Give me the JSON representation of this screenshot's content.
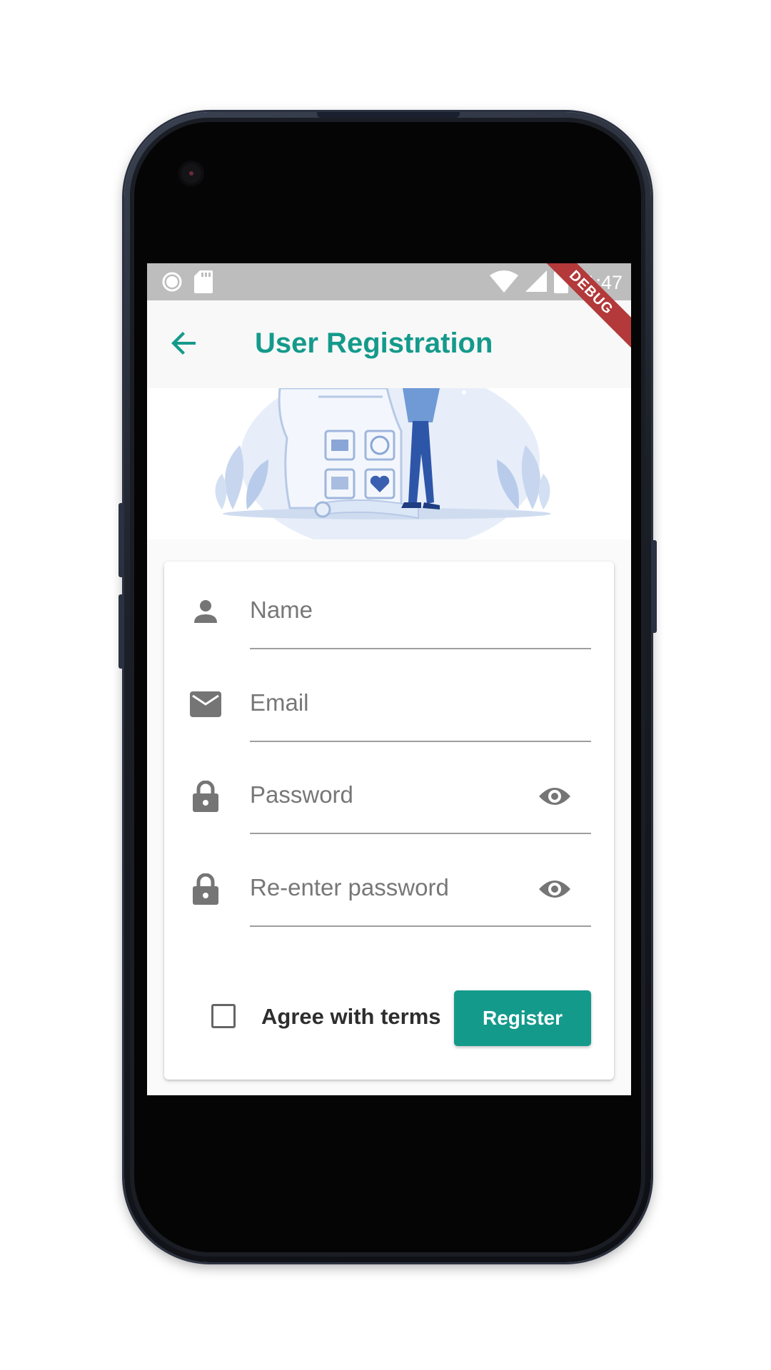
{
  "statusbar": {
    "time": "11:47",
    "icons": [
      "record-icon",
      "sd-card-icon",
      "wifi-icon",
      "signal-icon",
      "battery-icon"
    ]
  },
  "appbar": {
    "title": "User Registration",
    "back_icon": "arrow-back-icon",
    "debug_banner": "DEBUG"
  },
  "form": {
    "fields": [
      {
        "icon": "person-icon",
        "placeholder": "Name",
        "value": ""
      },
      {
        "icon": "email-icon",
        "placeholder": "Email",
        "value": ""
      },
      {
        "icon": "lock-icon",
        "placeholder": "Password",
        "value": "",
        "toggle_icon": "eye-icon"
      },
      {
        "icon": "lock-icon",
        "placeholder": "Re-enter password",
        "value": "",
        "toggle_icon": "eye-icon"
      }
    ],
    "agree_label": "Agree with terms",
    "agree_checked": false,
    "register_label": "Register"
  },
  "colors": {
    "accent": "#149a8b",
    "statusbar": "#bdbdbd",
    "debug": "#b3393a",
    "icon": "#757575"
  }
}
